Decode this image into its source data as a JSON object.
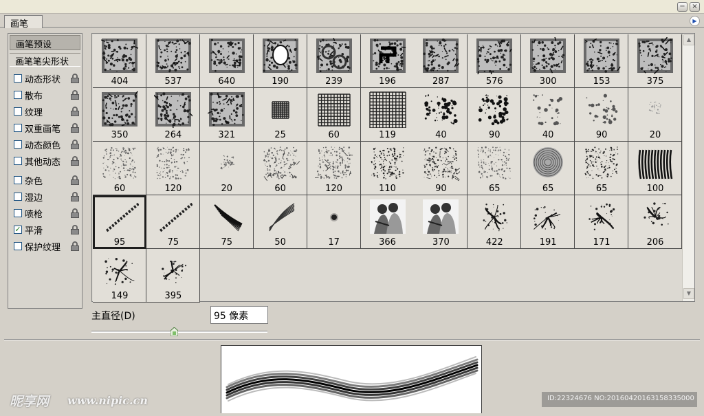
{
  "window": {
    "minimize_icon": "minimize-icon",
    "close_icon": "close-icon"
  },
  "panel": {
    "tab_label": "画笔",
    "menu_icon": "panel-menu-arrow-icon"
  },
  "sidebar": {
    "preset_button": "画笔预设",
    "tip_shape": "画笔笔尖形状",
    "options": [
      {
        "label": "动态形状",
        "checked": false
      },
      {
        "label": "散布",
        "checked": false
      },
      {
        "label": "纹理",
        "checked": false
      },
      {
        "label": "双重画笔",
        "checked": false
      },
      {
        "label": "动态颜色",
        "checked": false
      },
      {
        "label": "其他动态",
        "checked": false
      },
      {
        "label": "杂色",
        "checked": false
      },
      {
        "label": "湿边",
        "checked": false
      },
      {
        "label": "喷枪",
        "checked": false
      },
      {
        "label": "平滑",
        "checked": true
      },
      {
        "label": "保护纹理",
        "checked": false
      }
    ]
  },
  "brushes": [
    {
      "size": "404",
      "icon": "photo-stamp-icon"
    },
    {
      "size": "537",
      "icon": "portrait-stamp-icon"
    },
    {
      "size": "640",
      "icon": "grunge-frame-icon"
    },
    {
      "size": "190",
      "icon": "ornate-frame-icon"
    },
    {
      "size": "239",
      "icon": "handcuffs-icon"
    },
    {
      "size": "196",
      "icon": "emblem-icon"
    },
    {
      "size": "287",
      "icon": "figure-photo-icon"
    },
    {
      "size": "576",
      "icon": "knife-stamp-icon"
    },
    {
      "size": "300",
      "icon": "skull-stamp-icon"
    },
    {
      "size": "153",
      "icon": "eye-stamp-icon"
    },
    {
      "size": "375",
      "icon": "grunge-block-icon"
    },
    {
      "size": "350",
      "icon": "ruins-photo-icon"
    },
    {
      "size": "264",
      "icon": "torn-figure-icon"
    },
    {
      "size": "321",
      "icon": "tattoo-man-icon"
    },
    {
      "size": "25",
      "icon": "small-grid-icon"
    },
    {
      "size": "60",
      "icon": "medium-grid-icon"
    },
    {
      "size": "119",
      "icon": "large-grid-icon"
    },
    {
      "size": "40",
      "icon": "splatter-icon"
    },
    {
      "size": "90",
      "icon": "splatter-icon"
    },
    {
      "size": "40",
      "icon": "light-splatter-icon"
    },
    {
      "size": "90",
      "icon": "light-splatter-icon"
    },
    {
      "size": "20",
      "icon": "soft-dots-icon"
    },
    {
      "size": "60",
      "icon": "noise-texture-icon"
    },
    {
      "size": "120",
      "icon": "noise-texture-icon"
    },
    {
      "size": "20",
      "icon": "small-noise-icon"
    },
    {
      "size": "60",
      "icon": "scratch-texture-icon"
    },
    {
      "size": "120",
      "icon": "scratch-texture-icon"
    },
    {
      "size": "110",
      "icon": "dark-texture-icon"
    },
    {
      "size": "90",
      "icon": "stone-texture-icon"
    },
    {
      "size": "65",
      "icon": "speckle-texture-icon"
    },
    {
      "size": "65",
      "icon": "swirl-icon"
    },
    {
      "size": "65",
      "icon": "rough-texture-icon"
    },
    {
      "size": "100",
      "icon": "bristle-strokes-icon"
    },
    {
      "size": "95",
      "icon": "dashed-stroke-icon"
    },
    {
      "size": "75",
      "icon": "dashed-stroke-icon"
    },
    {
      "size": "75",
      "icon": "ink-stroke-icon"
    },
    {
      "size": "50",
      "icon": "feather-stroke-icon"
    },
    {
      "size": "17",
      "icon": "soft-round-icon"
    },
    {
      "size": "366",
      "icon": "couple-illustration-icon"
    },
    {
      "size": "370",
      "icon": "couple-illustration-icon"
    },
    {
      "size": "422",
      "icon": "ink-splash-icon"
    },
    {
      "size": "191",
      "icon": "dragon-ink-icon"
    },
    {
      "size": "171",
      "icon": "dragon-ink-icon"
    },
    {
      "size": "206",
      "icon": "ink-burst-icon"
    },
    {
      "size": "149",
      "icon": "ink-scatter-icon"
    },
    {
      "size": "395",
      "icon": "ink-scatter-icon"
    }
  ],
  "selected_index": 33,
  "diameter": {
    "label": "主直径(D)",
    "value": "95 像素",
    "slider_position_fraction": 0.47
  },
  "watermark": {
    "logo": "昵享网",
    "url": "www.nipic.cn",
    "id_text": "ID:22324676 NO:20160420163158335000"
  }
}
